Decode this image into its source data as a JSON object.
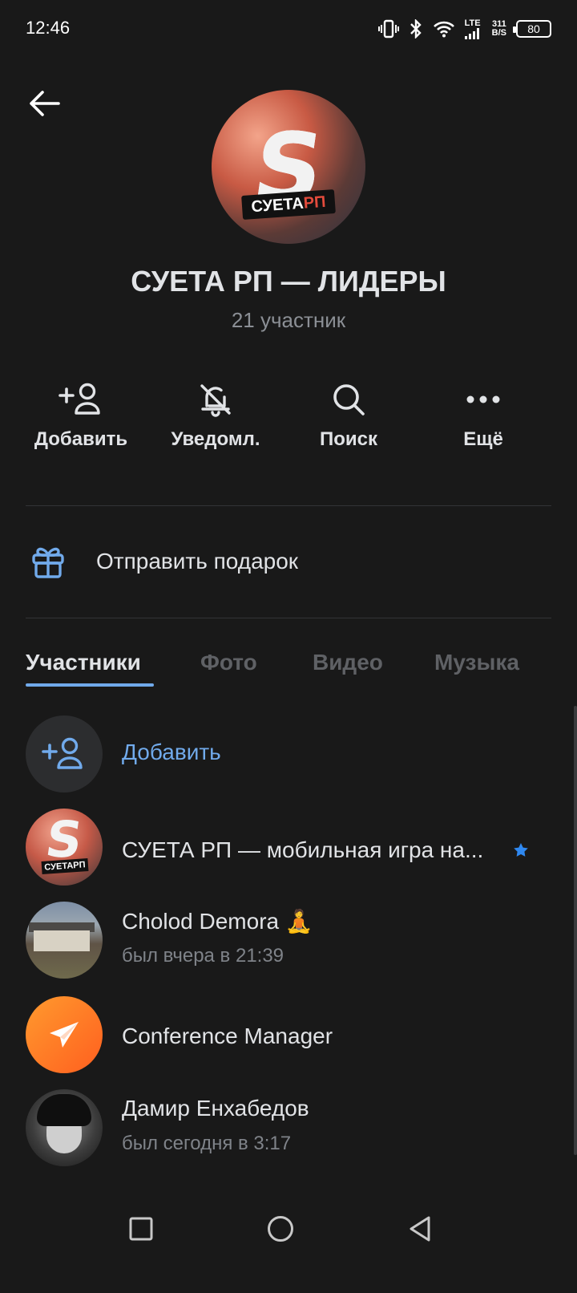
{
  "status_bar": {
    "time": "12:46",
    "lte": "LTE",
    "speed_value": "311",
    "speed_unit": "B/S",
    "battery": "80"
  },
  "header": {
    "title": "СУЕТА РП — ЛИДЕРЫ",
    "subtitle": "21 участник",
    "avatar_letter": "S",
    "avatar_logo_main": "СУЕТА",
    "avatar_logo_accent": "РП"
  },
  "actions": [
    {
      "label": "Добавить",
      "icon": "add-user-icon"
    },
    {
      "label": "Уведомл.",
      "icon": "bell-off-icon"
    },
    {
      "label": "Поиск",
      "icon": "search-icon"
    },
    {
      "label": "Ещё",
      "icon": "more-icon"
    }
  ],
  "gift": {
    "label": "Отправить подарок",
    "icon": "gift-icon"
  },
  "tabs": [
    "Участники",
    "Фото",
    "Видео",
    "Музыка"
  ],
  "members": {
    "add_label": "Добавить",
    "items": [
      {
        "name": "СУЕТА РП — мобильная игра на...",
        "status": "",
        "avatar_letter": "S",
        "avatar_logo": "СУЕТАРП"
      },
      {
        "name": "Cholod Demora 🧘",
        "status": "был вчера в 21:39"
      },
      {
        "name": "Conference Manager",
        "status": ""
      },
      {
        "name": "Дамир Енхабедов",
        "status": "был сегодня в 3:17"
      }
    ]
  },
  "colors": {
    "background": "#191919",
    "accent": "#71aaeb",
    "text": "#e1e3e6",
    "secondary": "#8b8f95"
  }
}
